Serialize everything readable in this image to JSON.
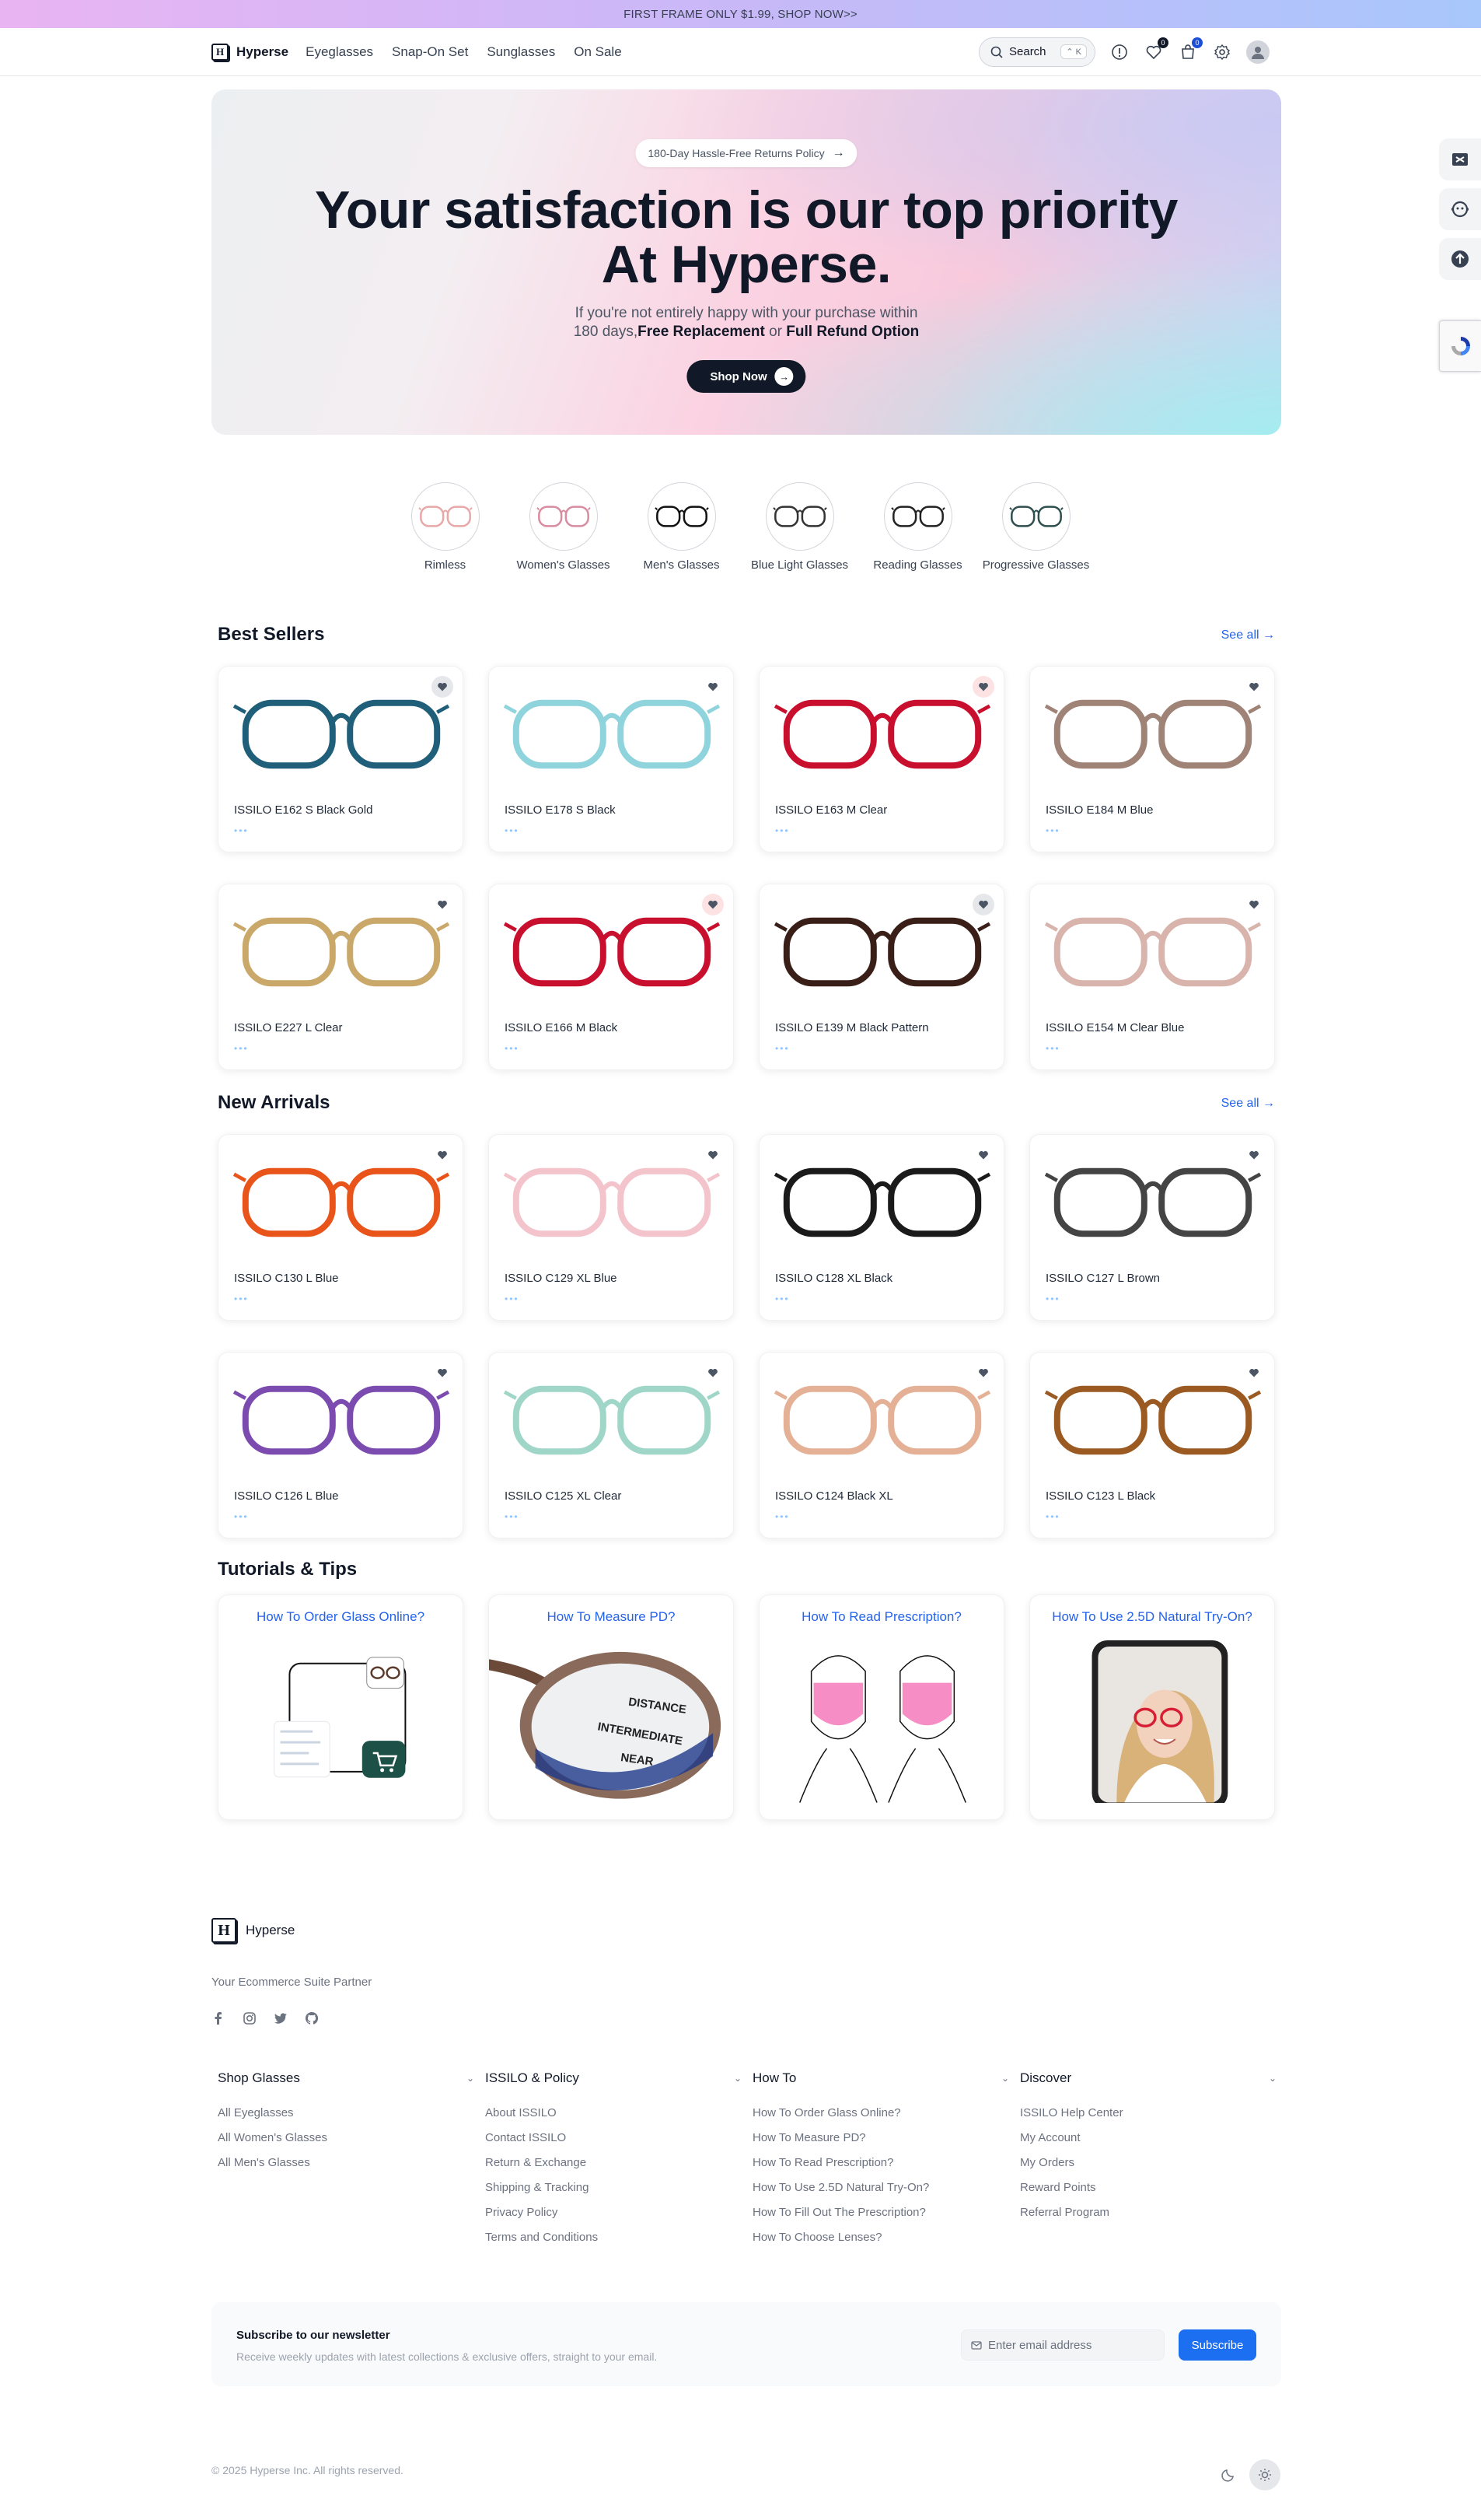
{
  "promo": "FIRST FRAME ONLY $1.99, SHOP NOW>>",
  "header": {
    "brand": "Hyperse",
    "brand_mark": "H",
    "nav": [
      "Eyeglasses",
      "Snap-On Set",
      "Sunglasses",
      "On Sale"
    ],
    "search_label": "Search",
    "search_kbd": "⌃ K",
    "wishlist_count": "0",
    "cart_count": "0",
    "icons": [
      "search-icon",
      "help-icon",
      "heart-icon",
      "cart-icon",
      "gear-icon",
      "user-icon"
    ]
  },
  "hero": {
    "pill": "180-Day Hassle-Free Returns Policy",
    "title_line1": "Your satisfaction is our top priority",
    "title_line2": "At Hyperse.",
    "text_line1": "If you're not entirely happy with your purchase within",
    "text_prefix": "180 days,",
    "text_bold1": "Free Replacement",
    "text_or": " or ",
    "text_bold2": "Full Refund Option",
    "cta": "Shop Now"
  },
  "categories": [
    {
      "label": "Rimless",
      "color": "#e8a8a8"
    },
    {
      "label": "Women's Glasses",
      "color": "#d98ba0"
    },
    {
      "label": "Men's Glasses",
      "color": "#111111"
    },
    {
      "label": "Blue Light Glasses",
      "color": "#333333"
    },
    {
      "label": "Reading Glasses",
      "color": "#222222"
    },
    {
      "label": "Progressive Glasses",
      "color": "#2f4f4f"
    }
  ],
  "best_sellers": {
    "title": "Best Sellers",
    "see_all": "See all →",
    "products": [
      {
        "name": "ISSILO E162 S Black Gold",
        "color": "#1f5f7a",
        "heart": "grey"
      },
      {
        "name": "ISSILO E178 S Black",
        "color": "#8fd3dc",
        "heart": "none"
      },
      {
        "name": "ISSILO E163 M Clear",
        "color": "#c8102e",
        "heart": "tint"
      },
      {
        "name": "ISSILO E184 M Blue",
        "color": "#a08377",
        "heart": "none"
      },
      {
        "name": "ISSILO E227 L Clear",
        "color": "#c9a86a",
        "heart": "none"
      },
      {
        "name": "ISSILO E166 M Black",
        "color": "#c8102e",
        "heart": "tint"
      },
      {
        "name": "ISSILO E139 M Black Pattern",
        "color": "#3a1f18",
        "heart": "grey"
      },
      {
        "name": "ISSILO E154 M Clear Blue",
        "color": "#d8b4ac",
        "heart": "none"
      }
    ]
  },
  "new_arrivals": {
    "title": "New Arrivals",
    "see_all": "See all →",
    "products": [
      {
        "name": "ISSILO C130 L Blue",
        "color": "#e8541a",
        "heart": "none"
      },
      {
        "name": "ISSILO C129 XL Blue",
        "color": "#f4c4cc",
        "heart": "none"
      },
      {
        "name": "ISSILO C128 XL Black",
        "color": "#1a1a1a",
        "heart": "none"
      },
      {
        "name": "ISSILO C127 L Brown",
        "color": "#444444",
        "heart": "none"
      },
      {
        "name": "ISSILO C126 L Blue",
        "color": "#7b4bb0",
        "heart": "none"
      },
      {
        "name": "ISSILO C125 XL Clear",
        "color": "#9fd6c8",
        "heart": "none"
      },
      {
        "name": "ISSILO C124 Black XL",
        "color": "#e4b096",
        "heart": "none"
      },
      {
        "name": "ISSILO C123 L Black",
        "color": "#9a5a22",
        "heart": "none"
      }
    ]
  },
  "tutorials": {
    "title": "Tutorials & Tips",
    "items": [
      {
        "title": "How To Order Glass Online?"
      },
      {
        "title": "How To Measure PD?",
        "labels": [
          "DISTANCE",
          "INTERMEDIATE",
          "NEAR"
        ]
      },
      {
        "title": "How To Read Prescription?"
      },
      {
        "title": "How To Use 2.5D Natural Try-On?"
      }
    ]
  },
  "footer": {
    "brand": "Hyperse",
    "tagline": "Your Ecommerce Suite Partner",
    "social_icons": [
      "facebook-icon",
      "instagram-icon",
      "twitter-icon",
      "github-icon"
    ],
    "columns": [
      {
        "title": "Shop Glasses",
        "links": [
          "All Eyeglasses",
          "All Women's Glasses",
          "All Men's Glasses"
        ]
      },
      {
        "title": "ISSILO & Policy",
        "links": [
          "About ISSILO",
          "Contact ISSILO",
          "Return & Exchange",
          "Shipping & Tracking",
          "Privacy Policy",
          "Terms and Conditions"
        ]
      },
      {
        "title": "How To",
        "links": [
          "How To Order Glass Online?",
          "How To Measure PD?",
          "How To Read Prescription?",
          "How To Use 2.5D Natural Try-On?",
          "How To Fill Out The Prescription?",
          "How To Choose Lenses?"
        ]
      },
      {
        "title": "Discover",
        "links": [
          "ISSILO Help Center",
          "My Account",
          "My Orders",
          "Reward Points",
          "Referral Program"
        ]
      }
    ],
    "newsletter": {
      "title": "Subscribe to our newsletter",
      "subtitle": "Receive weekly updates with latest collections & exclusive offers, straight to your email.",
      "placeholder": "Enter email address",
      "button": "Subscribe"
    },
    "copyright": "© 2025 Hyperse Inc. All rights reserved."
  },
  "colors": {
    "accent": "#2563eb",
    "dark": "#111827",
    "subscribe": "#1d6ff2"
  }
}
